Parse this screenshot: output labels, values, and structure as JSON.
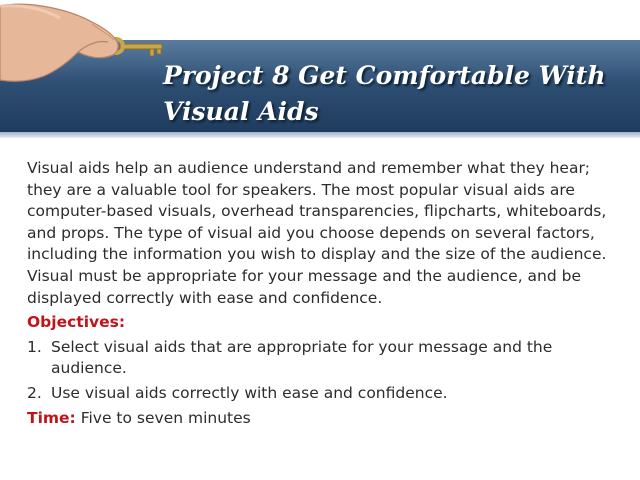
{
  "slide": {
    "title": "Project 8 Get Comfortable With Visual Aids",
    "intro": "Visual aids help an audience understand and remember what they hear; they are a valuable tool for speakers. The most popular visual aids are computer-based visuals, overhead transparencies, flipcharts, whiteboards, and props. The type of visual aid you choose depends on several factors, including the information you wish to display and the size of the audience. Visual must be appropriate for your message and the audience, and be displayed correctly with ease and confidence.",
    "objectives_heading": "Objectives:",
    "objectives": [
      {
        "number": "1.",
        "text": "Select visual aids that are appropriate for your message and the audience."
      },
      {
        "number": "2.",
        "text": "Use visual aids correctly with ease and confidence."
      }
    ],
    "time_label": "Time:",
    "time_value": "Five to seven minutes"
  },
  "colors": {
    "banner": "#2e4f73",
    "accent_red": "#c0141b",
    "body_text": "#2c2c2c"
  },
  "icons": [
    "hand-holding-key-icon"
  ]
}
